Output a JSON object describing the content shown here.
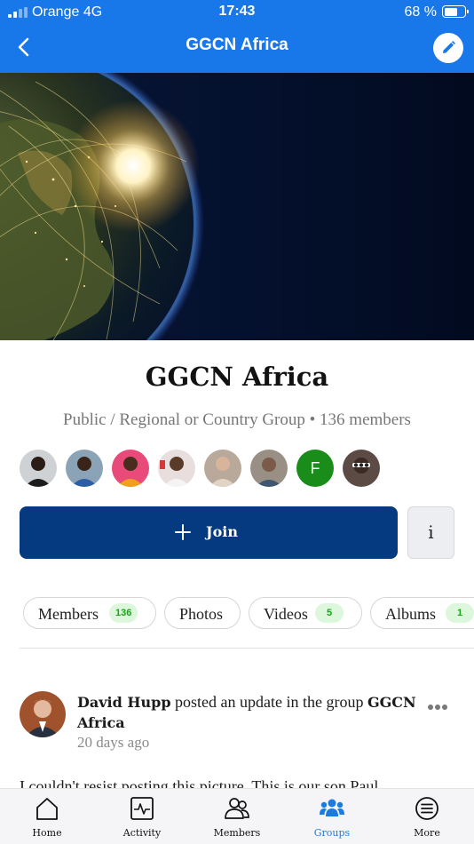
{
  "status_bar": {
    "carrier": "Orange  4G",
    "time": "17:43",
    "battery": "68 %",
    "battery_level": 0.68
  },
  "header": {
    "title": "GGCN Africa",
    "back_icon": "chevron-left-icon",
    "edit_icon": "pencil-icon"
  },
  "group": {
    "name": "GGCN Africa",
    "meta": "Public / Regional or Country Group • 136 members",
    "member_avatar_letter": "F",
    "join_label": "Join",
    "info_label": "i"
  },
  "tabs": [
    {
      "label": "Members",
      "count": "136"
    },
    {
      "label": "Photos"
    },
    {
      "label": "Videos",
      "count": "5"
    },
    {
      "label": "Albums",
      "count": "1"
    }
  ],
  "post": {
    "author": "David Hupp",
    "action": " posted an update in the group ",
    "group": "GGCN Africa",
    "time": "20 days ago",
    "body": "I couldn't resist posting this picture. This is our son Paul"
  },
  "bottom_nav": [
    {
      "label": "Home",
      "icon": "home-icon"
    },
    {
      "label": "Activity",
      "icon": "activity-icon"
    },
    {
      "label": "Members",
      "icon": "members-icon"
    },
    {
      "label": "Groups",
      "icon": "groups-icon",
      "active": true
    },
    {
      "label": "More",
      "icon": "more-menu-icon"
    }
  ],
  "colors": {
    "header_blue": "#1877e9",
    "join_button": "#053a80",
    "active_nav": "#1a7ce0",
    "badge_green": "#19a419"
  }
}
